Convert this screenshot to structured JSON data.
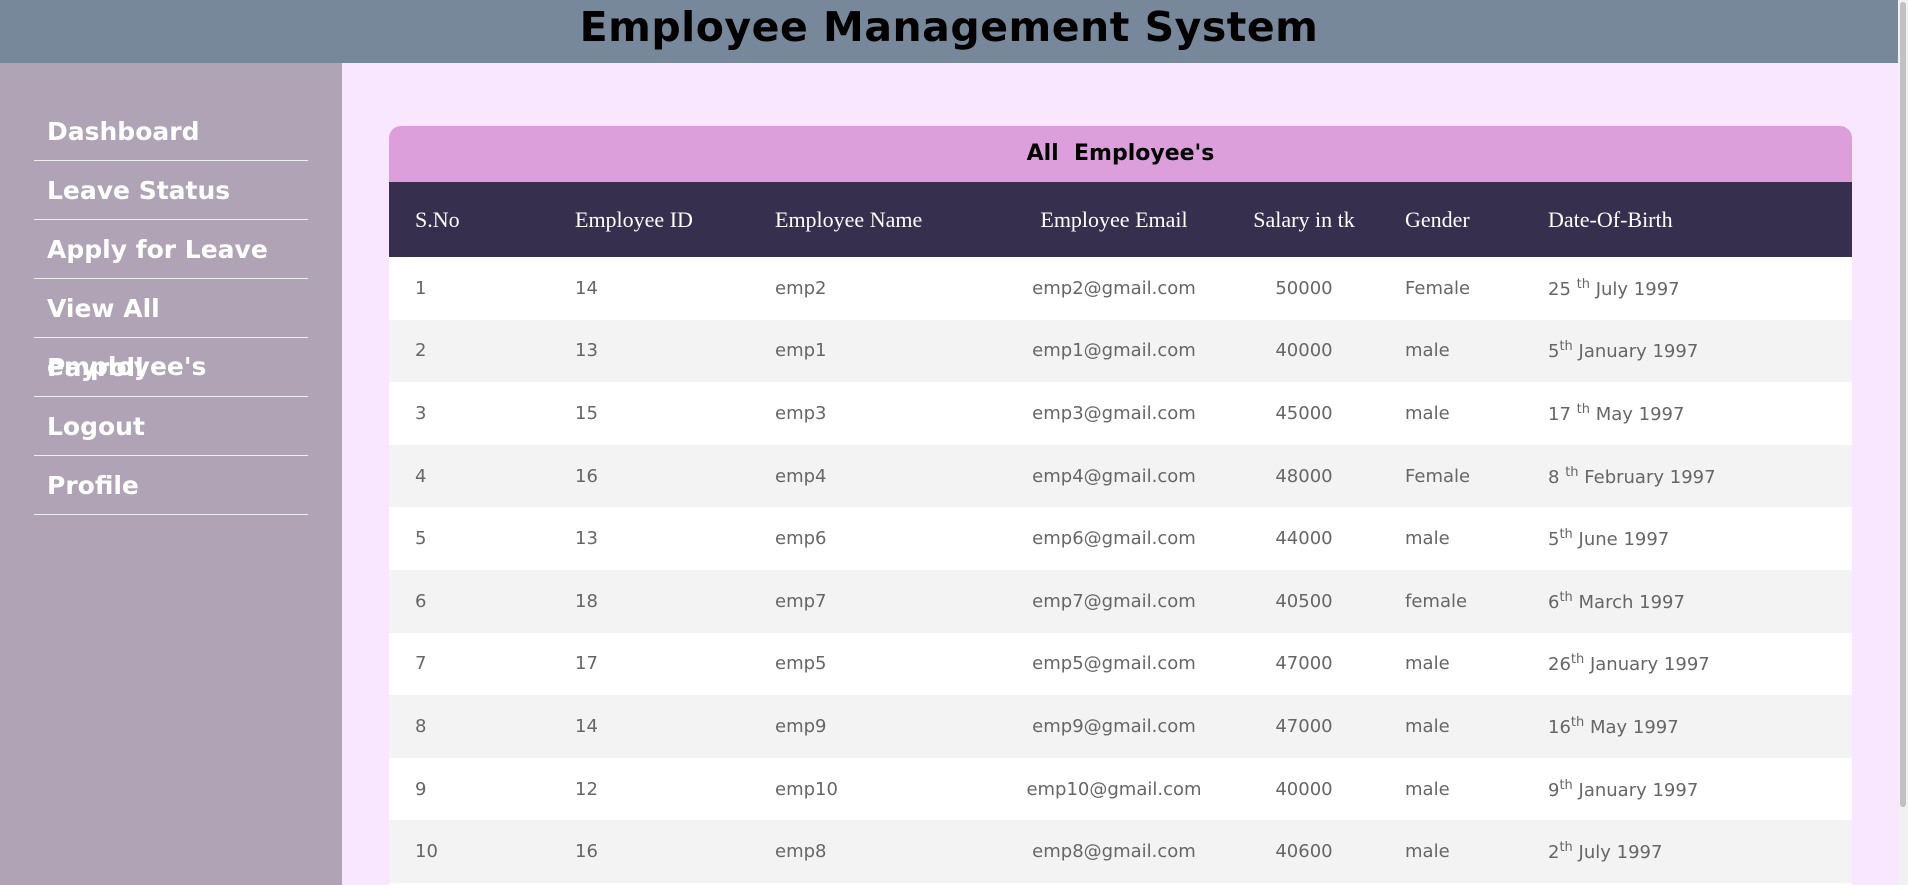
{
  "app": {
    "title": "Employee Management System"
  },
  "sidebar": {
    "items": [
      {
        "label": "Dashboard"
      },
      {
        "label": "Leave Status"
      },
      {
        "label": "Apply for Leave"
      },
      {
        "label": "View All employee's"
      },
      {
        "label": "Payroll"
      },
      {
        "label": "Logout"
      },
      {
        "label": "Profile"
      }
    ]
  },
  "table": {
    "title": "All  Employee's",
    "headers": {
      "sno": "S.No",
      "id": "Employee ID",
      "name": "Employee Name",
      "email": "Employee Email",
      "salary": "Salary in tk",
      "gender": "Gender",
      "dob": "Date-Of-Birth"
    },
    "rows": [
      {
        "sno": "1",
        "id": "14",
        "name": "emp2",
        "email": "emp2@gmail.com",
        "salary": "50000",
        "gender": "Female",
        "dob_day": "25 ",
        "dob_suffix": "th",
        "dob_rest": " July 1997"
      },
      {
        "sno": "2",
        "id": "13",
        "name": "emp1",
        "email": "emp1@gmail.com",
        "salary": "40000",
        "gender": "male",
        "dob_day": "5",
        "dob_suffix": "th",
        "dob_rest": " January 1997"
      },
      {
        "sno": "3",
        "id": "15",
        "name": "emp3",
        "email": "emp3@gmail.com",
        "salary": "45000",
        "gender": "male",
        "dob_day": "17 ",
        "dob_suffix": "th",
        "dob_rest": " May 1997"
      },
      {
        "sno": "4",
        "id": "16",
        "name": "emp4",
        "email": "emp4@gmail.com",
        "salary": "48000",
        "gender": "Female",
        "dob_day": "8 ",
        "dob_suffix": "th",
        "dob_rest": " February 1997"
      },
      {
        "sno": "5",
        "id": "13",
        "name": "emp6",
        "email": "emp6@gmail.com",
        "salary": "44000",
        "gender": "male",
        "dob_day": "5",
        "dob_suffix": "th",
        "dob_rest": " June 1997"
      },
      {
        "sno": "6",
        "id": "18",
        "name": "emp7",
        "email": "emp7@gmail.com",
        "salary": "40500",
        "gender": "female",
        "dob_day": "6",
        "dob_suffix": "th",
        "dob_rest": " March 1997"
      },
      {
        "sno": "7",
        "id": "17",
        "name": "emp5",
        "email": "emp5@gmail.com",
        "salary": "47000",
        "gender": "male",
        "dob_day": "26",
        "dob_suffix": "th",
        "dob_rest": " January 1997"
      },
      {
        "sno": "8",
        "id": "14",
        "name": "emp9",
        "email": "emp9@gmail.com",
        "salary": "47000",
        "gender": "male",
        "dob_day": "16",
        "dob_suffix": "th",
        "dob_rest": " May 1997"
      },
      {
        "sno": "9",
        "id": "12",
        "name": "emp10",
        "email": "emp10@gmail.com",
        "salary": "40000",
        "gender": "male",
        "dob_day": "9",
        "dob_suffix": "th",
        "dob_rest": " January 1997"
      },
      {
        "sno": "10",
        "id": "16",
        "name": "emp8",
        "email": "emp8@gmail.com",
        "salary": "40600",
        "gender": "male",
        "dob_day": "2",
        "dob_suffix": "th",
        "dob_rest": " July 1997"
      }
    ]
  },
  "colors": {
    "header_bg": "#76889a",
    "sidebar_bg": "#b0a3b5",
    "page_bg": "#f9e6ff",
    "card_title_bg": "#dc9fdc",
    "table_head_bg": "#362f4e"
  }
}
